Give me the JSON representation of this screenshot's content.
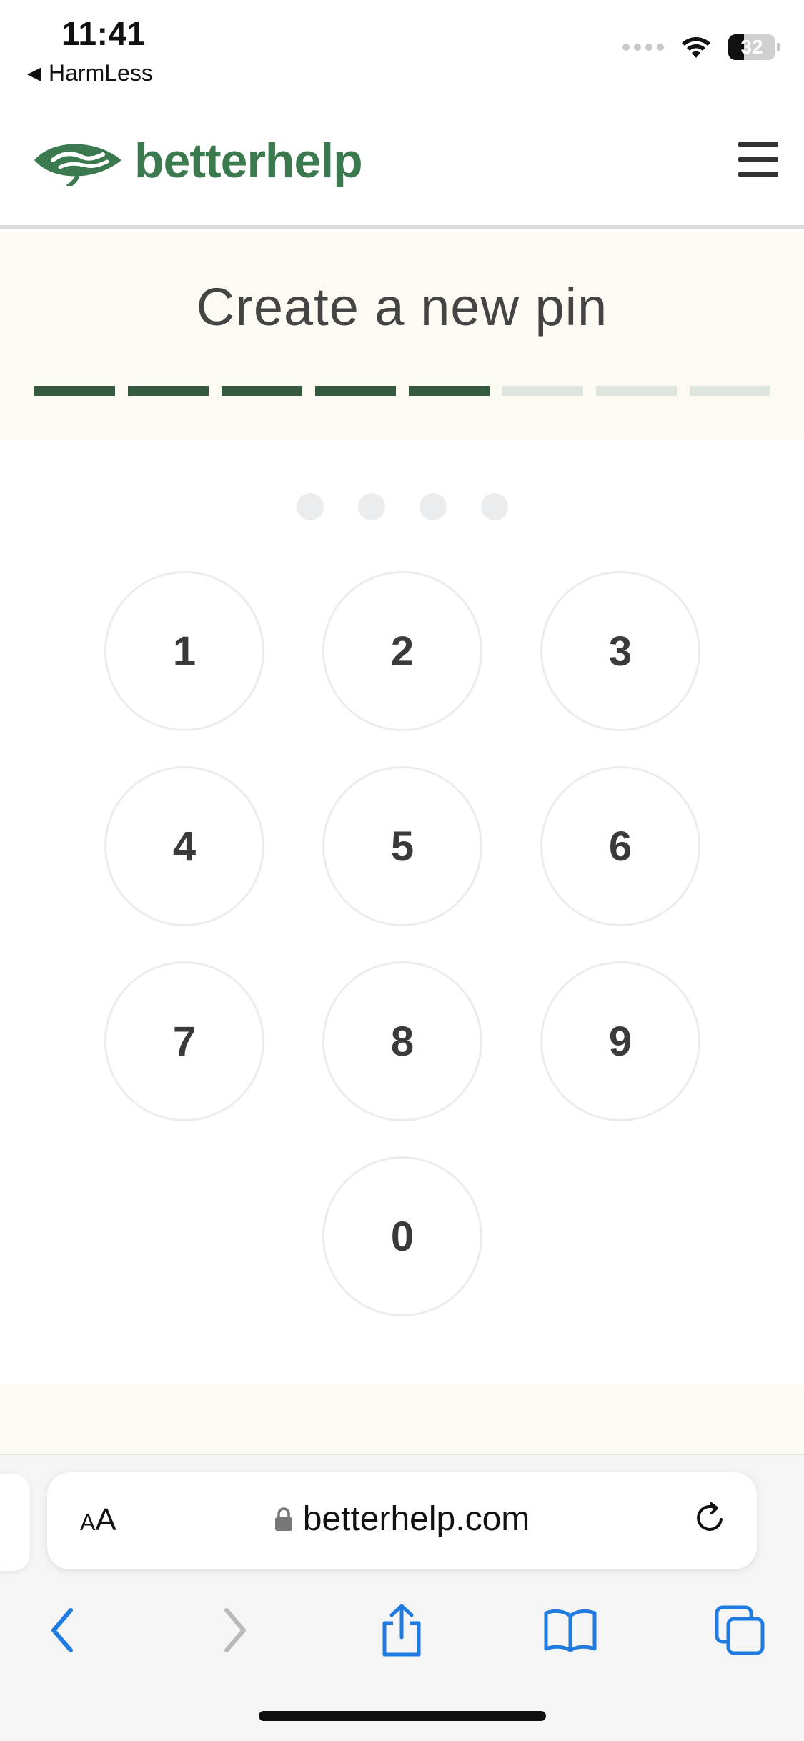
{
  "status_bar": {
    "time": "11:41",
    "back_app": "HarmLess",
    "battery": "32"
  },
  "header": {
    "logo_text": "betterhelp"
  },
  "pin": {
    "title": "Create a new pin",
    "progress": {
      "steps_total": 8,
      "steps_done": 5
    },
    "entered_digits": 0,
    "max_digits": 4
  },
  "keypad": {
    "keys": [
      "1",
      "2",
      "3",
      "4",
      "5",
      "6",
      "7",
      "8",
      "9",
      "0"
    ]
  },
  "browser": {
    "text_size_label_small": "A",
    "text_size_label_large": "A",
    "url": "betterhelp.com"
  },
  "colors": {
    "brand": "#3b7a4f",
    "progress_done": "#33593f",
    "progress_todo": "#dde4dd",
    "accent_blue": "#1f7be0"
  }
}
